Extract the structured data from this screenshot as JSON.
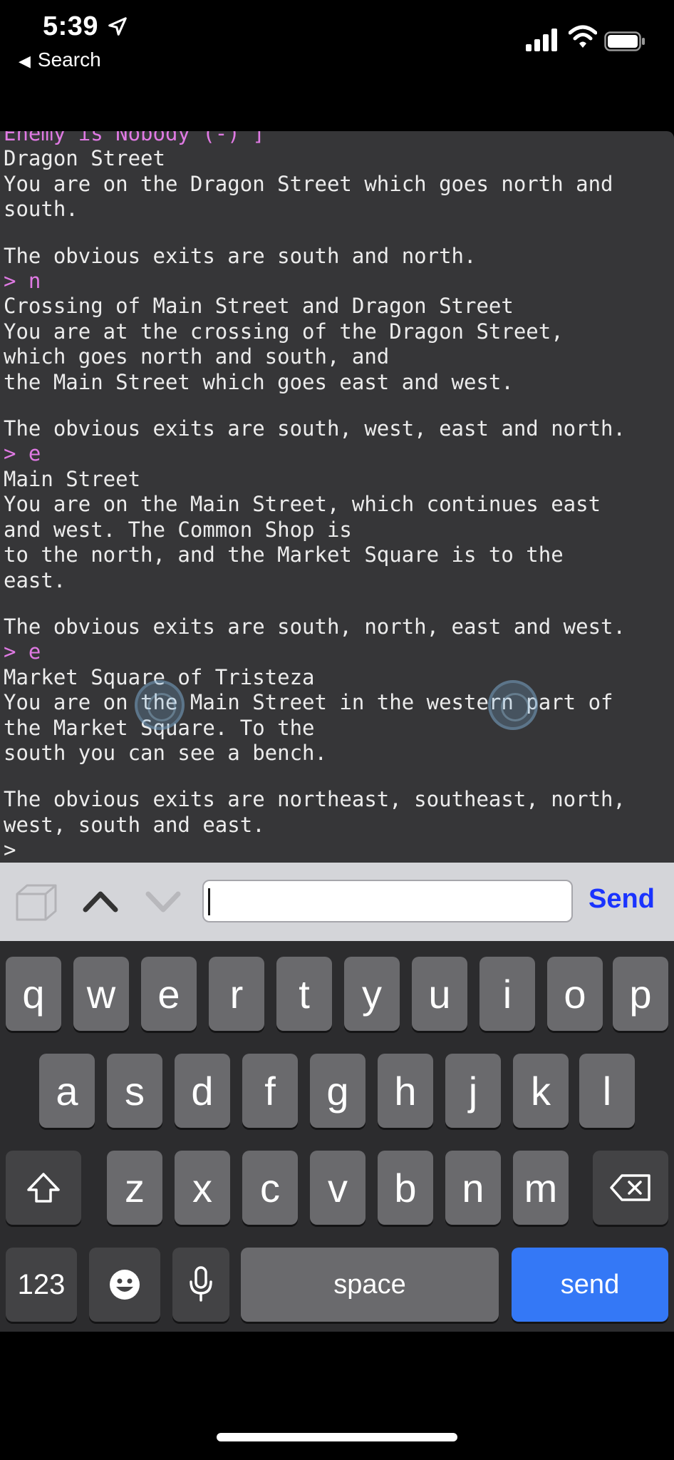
{
  "status_bar": {
    "time": "5:39",
    "back_label": "Search"
  },
  "terminal": {
    "lines": [
      {
        "text": "Enemy is Nobody (-) ]",
        "cmd": true
      },
      {
        "text": "Dragon Street"
      },
      {
        "text": "You are on the Dragon Street which goes north and"
      },
      {
        "text": "south."
      },
      {
        "text": "",
        "blank": true
      },
      {
        "text": "The obvious exits are south and north."
      },
      {
        "text": "> n",
        "cmd": true
      },
      {
        "text": "Crossing of Main Street and Dragon Street"
      },
      {
        "text": "You are at the crossing of the Dragon Street,"
      },
      {
        "text": "which goes north and south, and"
      },
      {
        "text": "the Main Street which goes east and west."
      },
      {
        "text": "",
        "blank": true
      },
      {
        "text": "The obvious exits are south, west, east and north."
      },
      {
        "text": "> e",
        "cmd": true
      },
      {
        "text": "Main Street"
      },
      {
        "text": "You are on the Main Street, which continues east"
      },
      {
        "text": "and west. The Common Shop is"
      },
      {
        "text": "to the north, and the Market Square is to the"
      },
      {
        "text": "east."
      },
      {
        "text": "",
        "blank": true
      },
      {
        "text": "The obvious exits are south, north, east and west."
      },
      {
        "text": "> e",
        "cmd": true
      },
      {
        "text": "Market Square of Tristeza"
      },
      {
        "text": "You are on the Main Street in the western part of"
      },
      {
        "text": "the Market Square. To the"
      },
      {
        "text": "south you can see a bench."
      },
      {
        "text": "",
        "blank": true
      },
      {
        "text": "The obvious exits are northeast, southeast, north,"
      },
      {
        "text": "west, south and east."
      },
      {
        "text": ">"
      }
    ]
  },
  "toolbar": {
    "box_icon": "box-icon",
    "up_icon": "chevron-up-icon",
    "down_icon": "chevron-down-icon",
    "input_value": "",
    "send_label": "Send"
  },
  "keyboard": {
    "row1": [
      "q",
      "w",
      "e",
      "r",
      "t",
      "y",
      "u",
      "i",
      "o",
      "p"
    ],
    "row2": [
      "a",
      "s",
      "d",
      "f",
      "g",
      "h",
      "j",
      "k",
      "l"
    ],
    "row3": [
      "z",
      "x",
      "c",
      "v",
      "b",
      "n",
      "m"
    ],
    "numbers_label": "123",
    "space_label": "space",
    "send_label": "send"
  },
  "colors": {
    "terminal_bg": "#363638",
    "command_text": "#e07ae4",
    "send_button": "#3478f6",
    "send_link": "#1a33ff"
  }
}
